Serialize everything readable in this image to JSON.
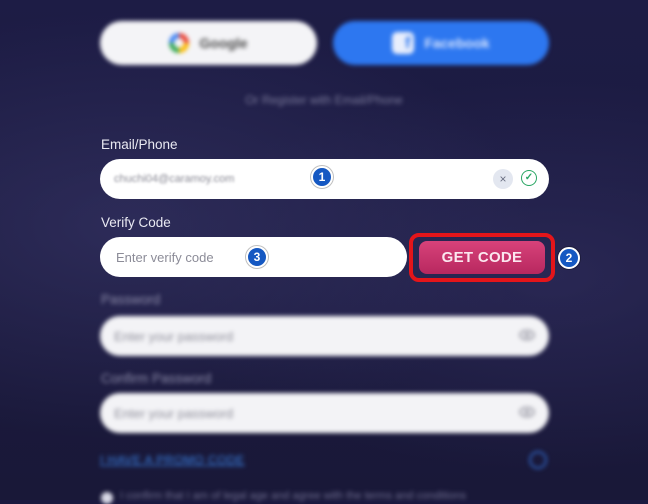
{
  "social": {
    "google_label": "Google",
    "facebook_label": "Facebook"
  },
  "divider": "Or Register with Email/Phone",
  "email": {
    "label": "Email/Phone",
    "value": "chuchi04@caramoy.com",
    "clear_glyph": "×",
    "valid_glyph": "✓"
  },
  "verify": {
    "label": "Verify Code",
    "placeholder": "Enter verify code",
    "get_code_label": "GET CODE"
  },
  "password": {
    "label": "Password",
    "placeholder": "Enter your password"
  },
  "confirm_password": {
    "label": "Confirm Password",
    "placeholder": "Enter your password"
  },
  "promo": {
    "link_text": "I HAVE A PROMO CODE"
  },
  "terms": {
    "text": "I confirm that I am of legal age and agree with the terms and conditions"
  },
  "markers": {
    "step1": "1",
    "step2": "2",
    "step3": "3"
  },
  "colors": {
    "background": "#1a1940",
    "facebook": "#2d77f0",
    "get_code": "#c8346c",
    "highlight": "#e4151a",
    "marker": "#1558c2"
  }
}
